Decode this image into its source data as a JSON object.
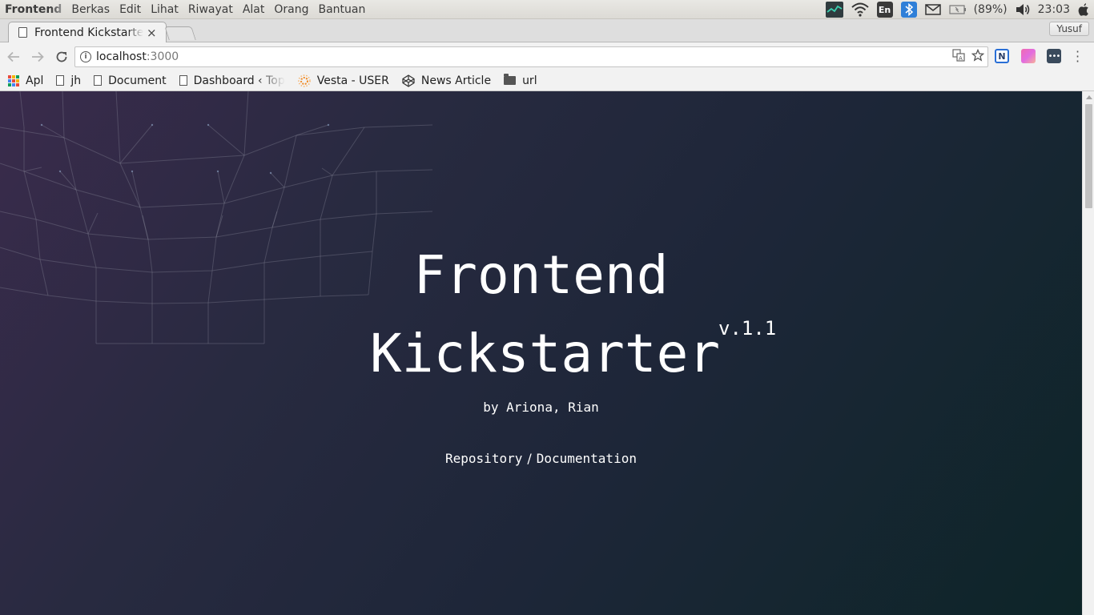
{
  "system_bar": {
    "app_name": "Frontend",
    "menu": [
      "Berkas",
      "Edit",
      "Lihat",
      "Riwayat",
      "Alat",
      "Orang",
      "Bantuan"
    ],
    "keyboard_layout": "En",
    "battery": "(89%)",
    "clock": "23:03"
  },
  "tab": {
    "title": "Frontend Kickstarter",
    "close": "×"
  },
  "profile": "Yusuf",
  "address": {
    "host": "localhost",
    "port": ":3000"
  },
  "bookmarks": [
    {
      "label": "Apl",
      "icon": "apps-grid-icon"
    },
    {
      "label": "jh",
      "icon": "page-icon"
    },
    {
      "label": "Document",
      "icon": "page-icon"
    },
    {
      "label": "Dashboard ‹ Top",
      "icon": "page-icon"
    },
    {
      "label": "Vesta - USER",
      "icon": "sun-icon"
    },
    {
      "label": "News Article",
      "icon": "codepen-icon"
    },
    {
      "label": "url",
      "icon": "folder-icon"
    }
  ],
  "hero": {
    "title_line1": "Frontend",
    "title_line2": "Kickstarter",
    "version": "v.1.1",
    "authors": "by Ariona, Rian",
    "link_repository": "Repository",
    "link_separator": "/",
    "link_documentation": "Documentation"
  },
  "colors": {
    "page_gradient_start": "#3a2b4c",
    "page_gradient_end": "#0d2528",
    "hero_text": "#ffffff"
  }
}
